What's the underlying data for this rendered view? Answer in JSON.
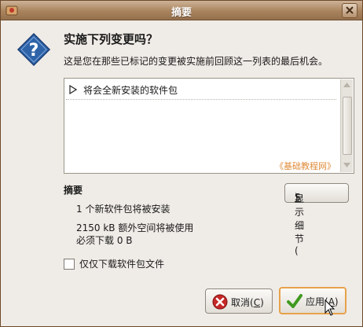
{
  "window": {
    "title": "摘要"
  },
  "dialog": {
    "heading": "实施下列变更吗？",
    "description": "这是您在那些已标记的变更被实施前回顾这一列表的最后机会。"
  },
  "changes_list": {
    "rows": [
      {
        "label": "将会全新安装的软件包",
        "expanded": false
      }
    ],
    "watermark": "《基础教程网》"
  },
  "summary": {
    "title": "摘要",
    "new_packages": "1 个新软件包将被安装",
    "disk_usage": "2150 kB 额外空间将被使用",
    "download_size": "必须下载 0 B"
  },
  "buttons": {
    "details": {
      "label": "显示细节(",
      "mnemonic": "S",
      "suffix": ")"
    },
    "cancel": {
      "label": "取消(",
      "mnemonic": "C",
      "suffix": ")"
    },
    "apply": {
      "label": "应用(",
      "mnemonic": "A",
      "suffix": ")"
    }
  },
  "download_only": {
    "label": "仅仅下载软件包文件",
    "checked": false
  },
  "colors": {
    "titlebar": "#a9835d",
    "watermark": "#e08c3a",
    "apply_focus": "#e7a24a",
    "question_icon": "#2e63a8"
  }
}
